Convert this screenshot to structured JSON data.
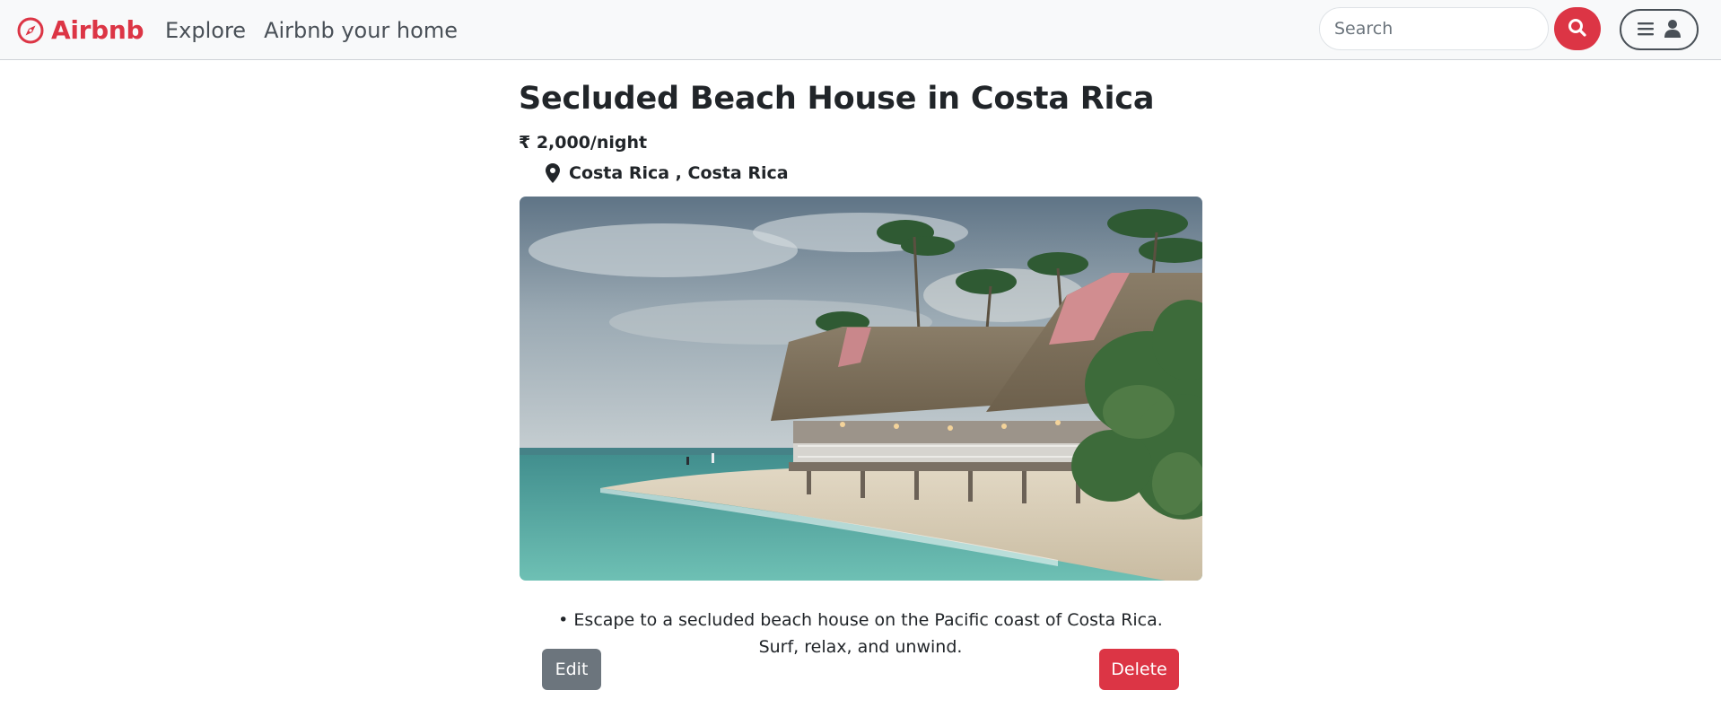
{
  "navbar": {
    "brand": "Airbnb",
    "brand_icon": "compass-icon",
    "links": [
      "Explore",
      "Airbnb your home"
    ],
    "search_placeholder": "Search",
    "search_icon": "search-icon",
    "menu_icon": "hamburger-icon",
    "user_icon": "user-icon"
  },
  "listing": {
    "title": "Secluded Beach House in Costa Rica",
    "price": "₹ 2,000/night",
    "location_icon": "map-pin-icon",
    "location": "Costa Rica , Costa Rica",
    "description": "• Escape to a secluded beach house on the Pacific coast of Costa Rica. Surf, relax, and unwind."
  },
  "actions": {
    "edit_label": "Edit",
    "delete_label": "Delete"
  },
  "colors": {
    "brand": "#dc3545",
    "navbar_bg": "#f8f9fa",
    "secondary": "#6c757d",
    "text": "#212529"
  }
}
